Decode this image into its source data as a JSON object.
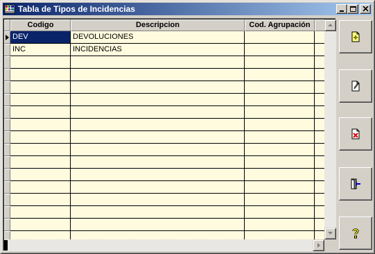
{
  "window": {
    "title": "Tabla de Tipos de Incidencias"
  },
  "grid": {
    "columns": [
      {
        "label": "Codigo"
      },
      {
        "label": "Descripcion"
      },
      {
        "label": "Cod. Agrupación"
      },
      {
        "label": ""
      }
    ],
    "rows": [
      {
        "codigo": "DEV",
        "descripcion": "DEVOLUCIONES",
        "agrupacion": ""
      },
      {
        "codigo": "INC",
        "descripcion": "INCIDENCIAS",
        "agrupacion": ""
      }
    ],
    "selected_row": 0,
    "selected_column": "codigo"
  },
  "toolbar": {
    "buttons": [
      {
        "name": "add-record-button",
        "icon": "new-document-icon"
      },
      {
        "name": "edit-record-button",
        "icon": "edit-document-icon"
      },
      {
        "name": "delete-record-button",
        "icon": "delete-document-icon"
      },
      {
        "name": "exit-button",
        "icon": "exit-door-icon"
      },
      {
        "name": "help-button",
        "icon": "help-question-icon"
      }
    ]
  },
  "colors": {
    "grid_background": "#fffbdf",
    "selection": "#0a246a",
    "titlebar_start": "#0a246a",
    "titlebar_end": "#a6caf0"
  }
}
